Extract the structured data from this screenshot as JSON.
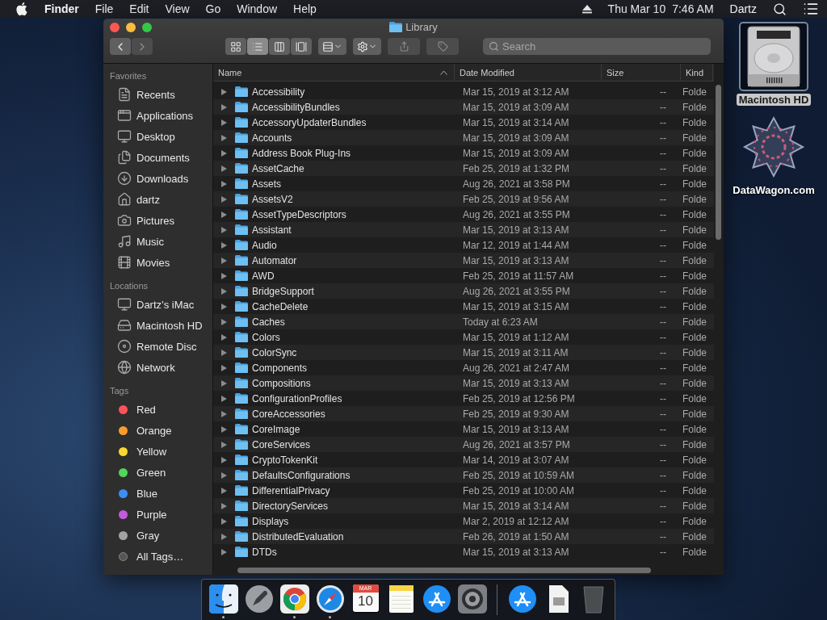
{
  "menubar": {
    "app": "Finder",
    "menus": [
      "File",
      "Edit",
      "View",
      "Go",
      "Window",
      "Help"
    ],
    "date": "Thu Mar 10",
    "time": "7:46 AM",
    "user": "Dartz"
  },
  "window": {
    "title": "Library",
    "search": {
      "placeholder": "Search"
    },
    "back_disabled": false,
    "forward_disabled": true,
    "views": [
      {
        "kind": "icons",
        "selected": false
      },
      {
        "kind": "list",
        "selected": true
      },
      {
        "kind": "columns",
        "selected": false
      },
      {
        "kind": "gallery",
        "selected": false
      }
    ],
    "share_disabled": true,
    "tags_disabled": true
  },
  "sidebar": [
    {
      "heading": "Favorites",
      "items": [
        {
          "label": "Recents"
        },
        {
          "label": "Applications"
        },
        {
          "label": "Desktop"
        },
        {
          "label": "Documents"
        },
        {
          "label": "Downloads"
        },
        {
          "label": "dartz"
        },
        {
          "label": "Pictures"
        },
        {
          "label": "Music"
        },
        {
          "label": "Movies"
        }
      ]
    },
    {
      "heading": "Locations",
      "items": [
        {
          "label": "Dartz’s iMac"
        },
        {
          "label": "Macintosh HD"
        },
        {
          "label": "Remote Disc"
        },
        {
          "label": "Network"
        }
      ]
    },
    {
      "heading": "Tags",
      "items": [
        {
          "label": "Red",
          "color": "#ff5257"
        },
        {
          "label": "Orange",
          "color": "#f99b2c"
        },
        {
          "label": "Yellow",
          "color": "#fbd82f"
        },
        {
          "label": "Green",
          "color": "#53d45b"
        },
        {
          "label": "Blue",
          "color": "#3c8ef6"
        },
        {
          "label": "Purple",
          "color": "#c25cdb"
        },
        {
          "label": "Gray",
          "color": "#a3a3a6"
        },
        {
          "label": "All Tags…"
        }
      ]
    }
  ],
  "table": {
    "columns": [
      {
        "label": "Name",
        "sorted": true
      },
      {
        "label": "Date Modified",
        "sorted": false
      },
      {
        "label": "Size",
        "sorted": false
      },
      {
        "label": "Kind",
        "sorted": false
      }
    ],
    "rows": [
      {
        "name": "Accessibility",
        "date": "Mar 15, 2019 at 3:12 AM",
        "size": "--",
        "kind": "Folde"
      },
      {
        "name": "AccessibilityBundles",
        "date": "Mar 15, 2019 at 3:09 AM",
        "size": "--",
        "kind": "Folde"
      },
      {
        "name": "AccessoryUpdaterBundles",
        "date": "Mar 15, 2019 at 3:14 AM",
        "size": "--",
        "kind": "Folde"
      },
      {
        "name": "Accounts",
        "date": "Mar 15, 2019 at 3:09 AM",
        "size": "--",
        "kind": "Folde"
      },
      {
        "name": "Address Book Plug-Ins",
        "date": "Mar 15, 2019 at 3:09 AM",
        "size": "--",
        "kind": "Folde"
      },
      {
        "name": "AssetCache",
        "date": "Feb 25, 2019 at 1:32 PM",
        "size": "--",
        "kind": "Folde"
      },
      {
        "name": "Assets",
        "date": "Aug 26, 2021 at 3:58 PM",
        "size": "--",
        "kind": "Folde"
      },
      {
        "name": "AssetsV2",
        "date": "Feb 25, 2019 at 9:56 AM",
        "size": "--",
        "kind": "Folde"
      },
      {
        "name": "AssetTypeDescriptors",
        "date": "Aug 26, 2021 at 3:55 PM",
        "size": "--",
        "kind": "Folde"
      },
      {
        "name": "Assistant",
        "date": "Mar 15, 2019 at 3:13 AM",
        "size": "--",
        "kind": "Folde"
      },
      {
        "name": "Audio",
        "date": "Mar 12, 2019 at 1:44 AM",
        "size": "--",
        "kind": "Folde"
      },
      {
        "name": "Automator",
        "date": "Mar 15, 2019 at 3:13 AM",
        "size": "--",
        "kind": "Folde"
      },
      {
        "name": "AWD",
        "date": "Feb 25, 2019 at 11:57 AM",
        "size": "--",
        "kind": "Folde"
      },
      {
        "name": "BridgeSupport",
        "date": "Aug 26, 2021 at 3:55 PM",
        "size": "--",
        "kind": "Folde"
      },
      {
        "name": "CacheDelete",
        "date": "Mar 15, 2019 at 3:15 AM",
        "size": "--",
        "kind": "Folde"
      },
      {
        "name": "Caches",
        "date": "Today at 6:23 AM",
        "size": "--",
        "kind": "Folde"
      },
      {
        "name": "Colors",
        "date": "Mar 15, 2019 at 1:12 AM",
        "size": "--",
        "kind": "Folde"
      },
      {
        "name": "ColorSync",
        "date": "Mar 15, 2019 at 3:11 AM",
        "size": "--",
        "kind": "Folde"
      },
      {
        "name": "Components",
        "date": "Aug 26, 2021 at 2:47 AM",
        "size": "--",
        "kind": "Folde"
      },
      {
        "name": "Compositions",
        "date": "Mar 15, 2019 at 3:13 AM",
        "size": "--",
        "kind": "Folde"
      },
      {
        "name": "ConfigurationProfiles",
        "date": "Feb 25, 2019 at 12:56 PM",
        "size": "--",
        "kind": "Folde"
      },
      {
        "name": "CoreAccessories",
        "date": "Feb 25, 2019 at 9:30 AM",
        "size": "--",
        "kind": "Folde"
      },
      {
        "name": "CoreImage",
        "date": "Mar 15, 2019 at 3:13 AM",
        "size": "--",
        "kind": "Folde"
      },
      {
        "name": "CoreServices",
        "date": "Aug 26, 2021 at 3:57 PM",
        "size": "--",
        "kind": "Folde"
      },
      {
        "name": "CryptoTokenKit",
        "date": "Mar 14, 2019 at 3:07 AM",
        "size": "--",
        "kind": "Folde"
      },
      {
        "name": "DefaultsConfigurations",
        "date": "Feb 25, 2019 at 10:59 AM",
        "size": "--",
        "kind": "Folde"
      },
      {
        "name": "DifferentialPrivacy",
        "date": "Feb 25, 2019 at 10:00 AM",
        "size": "--",
        "kind": "Folde"
      },
      {
        "name": "DirectoryServices",
        "date": "Mar 15, 2019 at 3:14 AM",
        "size": "--",
        "kind": "Folde"
      },
      {
        "name": "Displays",
        "date": "Mar 2, 2019 at 12:12 AM",
        "size": "--",
        "kind": "Folde"
      },
      {
        "name": "DistributedEvaluation",
        "date": "Feb 26, 2019 at 1:50 AM",
        "size": "--",
        "kind": "Folde"
      },
      {
        "name": "DTDs",
        "date": "Mar 15, 2019 at 3:13 AM",
        "size": "--",
        "kind": "Folde"
      }
    ]
  },
  "desktop_icons": [
    {
      "label": "Macintosh HD",
      "kind": "disk",
      "selected": true
    },
    {
      "label": "DataWagon.com",
      "kind": "logo",
      "selected": false
    }
  ],
  "dock": {
    "items": [
      {
        "kind": "finder",
        "running": true
      },
      {
        "kind": "launchpad",
        "running": false
      },
      {
        "kind": "chrome",
        "running": true
      },
      {
        "kind": "safari",
        "running": true
      },
      {
        "kind": "calendar",
        "running": false,
        "month": "MAR",
        "day": "10"
      },
      {
        "kind": "notes",
        "running": false
      },
      {
        "kind": "appstore",
        "running": false
      },
      {
        "kind": "preferences",
        "running": false
      },
      {
        "kind": "separator"
      },
      {
        "kind": "appstore",
        "running": false
      },
      {
        "kind": "document",
        "running": false
      },
      {
        "kind": "trash",
        "running": false
      }
    ]
  }
}
